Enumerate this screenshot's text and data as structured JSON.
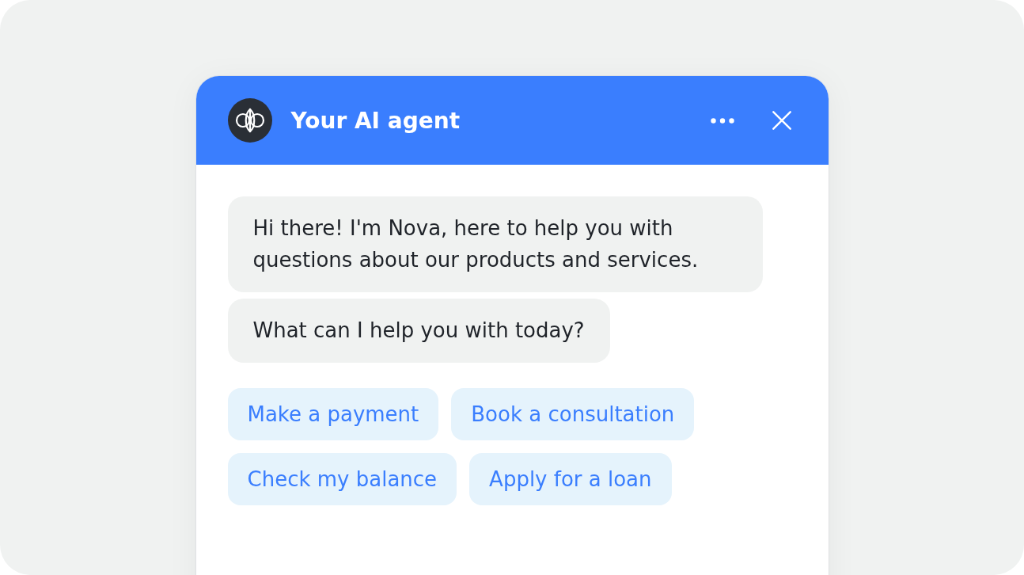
{
  "header": {
    "title": "Your AI agent"
  },
  "messages": [
    {
      "text": "Hi there! I'm Nova, here to help you with questions about our products and services."
    },
    {
      "text": "What can I help you with today?"
    }
  ],
  "quick_replies": [
    {
      "label": "Make a payment"
    },
    {
      "label": "Book a consultation"
    },
    {
      "label": "Check my balance"
    },
    {
      "label": "Apply for a loan"
    }
  ]
}
